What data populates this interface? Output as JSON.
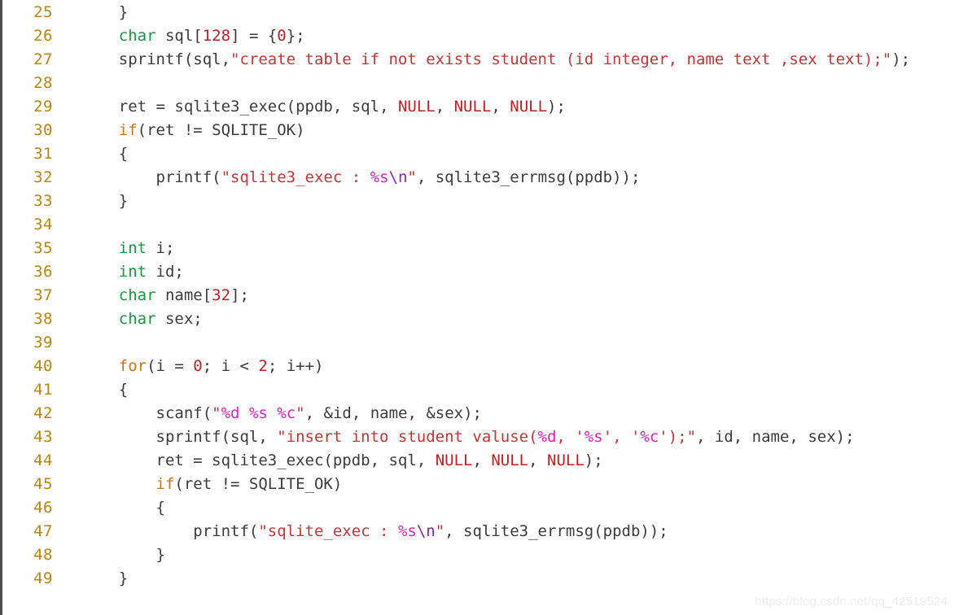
{
  "viewer": {
    "language": "c",
    "first_line": 25,
    "last_line": 49,
    "background_color": "#ffffff",
    "line_number_color": "#b8860b",
    "text_color": "#3b3b3b",
    "border_color": "#4d4d4f"
  },
  "watermark": {
    "text": "https://blog.csdn.net/qq_42519524"
  },
  "lines": [
    {
      "number": "25",
      "text": "    }",
      "tokens": [
        {
          "t": "    }",
          "c": "tok-plain"
        }
      ]
    },
    {
      "number": "26",
      "text": "    char sql[128] = {0};",
      "tokens": [
        {
          "t": "    ",
          "c": "tok-plain"
        },
        {
          "t": "char",
          "c": "tok-type"
        },
        {
          "t": " sql[",
          "c": "tok-plain"
        },
        {
          "t": "128",
          "c": "tok-num"
        },
        {
          "t": "] = {",
          "c": "tok-plain"
        },
        {
          "t": "0",
          "c": "tok-num"
        },
        {
          "t": "};",
          "c": "tok-plain"
        }
      ]
    },
    {
      "number": "27",
      "text": "    sprintf(sql,\"create table if not exists student (id integer, name text ,sex text);\");",
      "tokens": [
        {
          "t": "    sprintf(sql,",
          "c": "tok-plain"
        },
        {
          "t": "\"create table if not exists student (id integer, name text ,sex text);\"",
          "c": "tok-str"
        },
        {
          "t": ");",
          "c": "tok-plain"
        }
      ]
    },
    {
      "number": "28",
      "text": "",
      "tokens": []
    },
    {
      "number": "29",
      "text": "    ret = sqlite3_exec(ppdb, sql, NULL, NULL, NULL);",
      "tokens": [
        {
          "t": "    ret = sqlite3_exec(ppdb, sql, ",
          "c": "tok-plain"
        },
        {
          "t": "NULL",
          "c": "tok-const"
        },
        {
          "t": ", ",
          "c": "tok-plain"
        },
        {
          "t": "NULL",
          "c": "tok-const"
        },
        {
          "t": ", ",
          "c": "tok-plain"
        },
        {
          "t": "NULL",
          "c": "tok-const"
        },
        {
          "t": ");",
          "c": "tok-plain"
        }
      ]
    },
    {
      "number": "30",
      "text": "    if(ret != SQLITE_OK)",
      "tokens": [
        {
          "t": "    ",
          "c": "tok-plain"
        },
        {
          "t": "if",
          "c": "tok-kw"
        },
        {
          "t": "(ret != SQLITE_OK)",
          "c": "tok-plain"
        }
      ]
    },
    {
      "number": "31",
      "text": "    {",
      "tokens": [
        {
          "t": "    {",
          "c": "tok-plain"
        }
      ]
    },
    {
      "number": "32",
      "text": "        printf(\"sqlite3_exec : %s\\n\", sqlite3_errmsg(ppdb));",
      "tokens": [
        {
          "t": "        printf(",
          "c": "tok-plain"
        },
        {
          "t": "\"sqlite3_exec : ",
          "c": "tok-str"
        },
        {
          "t": "%s",
          "c": "tok-fmt"
        },
        {
          "t": "\\n",
          "c": "tok-esc"
        },
        {
          "t": "\"",
          "c": "tok-str"
        },
        {
          "t": ", sqlite3_errmsg(ppdb));",
          "c": "tok-plain"
        }
      ]
    },
    {
      "number": "33",
      "text": "    }",
      "tokens": [
        {
          "t": "    }",
          "c": "tok-plain"
        }
      ]
    },
    {
      "number": "34",
      "text": "",
      "tokens": []
    },
    {
      "number": "35",
      "text": "    int i;",
      "tokens": [
        {
          "t": "    ",
          "c": "tok-plain"
        },
        {
          "t": "int",
          "c": "tok-type"
        },
        {
          "t": " i;",
          "c": "tok-plain"
        }
      ]
    },
    {
      "number": "36",
      "text": "    int id;",
      "tokens": [
        {
          "t": "    ",
          "c": "tok-plain"
        },
        {
          "t": "int",
          "c": "tok-type"
        },
        {
          "t": " id;",
          "c": "tok-plain"
        }
      ]
    },
    {
      "number": "37",
      "text": "    char name[32];",
      "tokens": [
        {
          "t": "    ",
          "c": "tok-plain"
        },
        {
          "t": "char",
          "c": "tok-type"
        },
        {
          "t": " name[",
          "c": "tok-plain"
        },
        {
          "t": "32",
          "c": "tok-num"
        },
        {
          "t": "];",
          "c": "tok-plain"
        }
      ]
    },
    {
      "number": "38",
      "text": "    char sex;",
      "tokens": [
        {
          "t": "    ",
          "c": "tok-plain"
        },
        {
          "t": "char",
          "c": "tok-type"
        },
        {
          "t": " sex;",
          "c": "tok-plain"
        }
      ]
    },
    {
      "number": "39",
      "text": "",
      "tokens": []
    },
    {
      "number": "40",
      "text": "    for(i = 0; i < 2; i++)",
      "tokens": [
        {
          "t": "    ",
          "c": "tok-plain"
        },
        {
          "t": "for",
          "c": "tok-kw"
        },
        {
          "t": "(i = ",
          "c": "tok-plain"
        },
        {
          "t": "0",
          "c": "tok-num"
        },
        {
          "t": "; i < ",
          "c": "tok-plain"
        },
        {
          "t": "2",
          "c": "tok-num"
        },
        {
          "t": "; i++)",
          "c": "tok-plain"
        }
      ]
    },
    {
      "number": "41",
      "text": "    {",
      "tokens": [
        {
          "t": "    {",
          "c": "tok-plain"
        }
      ]
    },
    {
      "number": "42",
      "text": "        scanf(\"%d %s %c\", &id, name, &sex);",
      "tokens": [
        {
          "t": "        scanf(",
          "c": "tok-plain"
        },
        {
          "t": "\"",
          "c": "tok-str"
        },
        {
          "t": "%d",
          "c": "tok-fmt"
        },
        {
          "t": " ",
          "c": "tok-str"
        },
        {
          "t": "%s",
          "c": "tok-fmt"
        },
        {
          "t": " ",
          "c": "tok-str"
        },
        {
          "t": "%c",
          "c": "tok-fmt"
        },
        {
          "t": "\"",
          "c": "tok-str"
        },
        {
          "t": ", &id, name, &sex);",
          "c": "tok-plain"
        }
      ]
    },
    {
      "number": "43",
      "text": "        sprintf(sql, \"insert into student valuse(%d, '%s', '%c');\", id, name, sex);",
      "tokens": [
        {
          "t": "        sprintf(sql, ",
          "c": "tok-plain"
        },
        {
          "t": "\"insert into student valuse(",
          "c": "tok-str"
        },
        {
          "t": "%d",
          "c": "tok-fmt"
        },
        {
          "t": ", '",
          "c": "tok-str"
        },
        {
          "t": "%s",
          "c": "tok-fmt"
        },
        {
          "t": "', '",
          "c": "tok-str"
        },
        {
          "t": "%c",
          "c": "tok-fmt"
        },
        {
          "t": "');\"",
          "c": "tok-str"
        },
        {
          "t": ", id, name, sex);",
          "c": "tok-plain"
        }
      ]
    },
    {
      "number": "44",
      "text": "        ret = sqlite3_exec(ppdb, sql, NULL, NULL, NULL);",
      "tokens": [
        {
          "t": "        ret = sqlite3_exec(ppdb, sql, ",
          "c": "tok-plain"
        },
        {
          "t": "NULL",
          "c": "tok-const"
        },
        {
          "t": ", ",
          "c": "tok-plain"
        },
        {
          "t": "NULL",
          "c": "tok-const"
        },
        {
          "t": ", ",
          "c": "tok-plain"
        },
        {
          "t": "NULL",
          "c": "tok-const"
        },
        {
          "t": ");",
          "c": "tok-plain"
        }
      ]
    },
    {
      "number": "45",
      "text": "        if(ret != SQLITE_OK)",
      "tokens": [
        {
          "t": "        ",
          "c": "tok-plain"
        },
        {
          "t": "if",
          "c": "tok-kw"
        },
        {
          "t": "(ret != SQLITE_OK)",
          "c": "tok-plain"
        }
      ]
    },
    {
      "number": "46",
      "text": "        {",
      "tokens": [
        {
          "t": "        {",
          "c": "tok-plain"
        }
      ]
    },
    {
      "number": "47",
      "text": "            printf(\"sqlite_exec : %s\\n\", sqlite3_errmsg(ppdb));",
      "tokens": [
        {
          "t": "            printf(",
          "c": "tok-plain"
        },
        {
          "t": "\"sqlite_exec : ",
          "c": "tok-str"
        },
        {
          "t": "%s",
          "c": "tok-fmt"
        },
        {
          "t": "\\n",
          "c": "tok-esc"
        },
        {
          "t": "\"",
          "c": "tok-str"
        },
        {
          "t": ", sqlite3_errmsg(ppdb));",
          "c": "tok-plain"
        }
      ]
    },
    {
      "number": "48",
      "text": "        }",
      "tokens": [
        {
          "t": "        }",
          "c": "tok-plain"
        }
      ]
    },
    {
      "number": "49",
      "text": "    }",
      "tokens": [
        {
          "t": "    }",
          "c": "tok-plain"
        }
      ]
    }
  ]
}
